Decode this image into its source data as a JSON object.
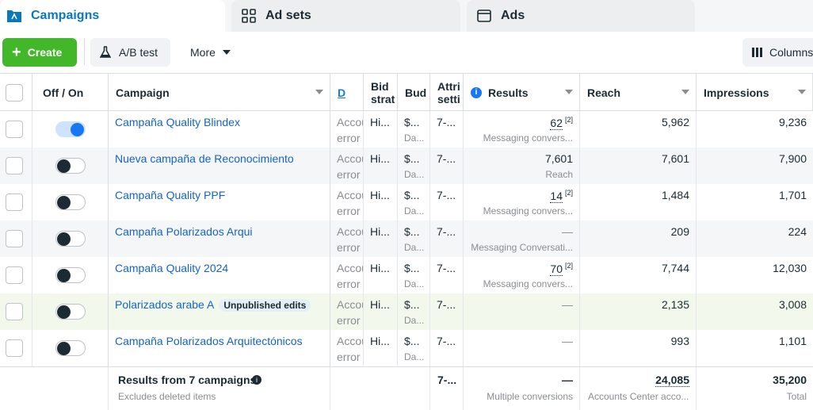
{
  "tabs": [
    {
      "label": "Campaigns",
      "icon": "folder-icon"
    },
    {
      "label": "Ad sets",
      "icon": "grid-icon"
    },
    {
      "label": "Ads",
      "icon": "ad-icon"
    }
  ],
  "toolbar": {
    "create_label": "Create",
    "ab_test_label": "A/B test",
    "more_label": "More",
    "columns_label": "Columns"
  },
  "columns": {
    "off_on": "Off / On",
    "campaign": "Campaign",
    "delivery": "D",
    "bid_strategy_line1": "Bid",
    "bid_strategy_line2": "strat",
    "budget": "Bud",
    "attribution_line1": "Attri",
    "attribution_line2": "setti",
    "results": "Results",
    "reach": "Reach",
    "impressions": "Impressions"
  },
  "rows": [
    {
      "campaign": "Campaña Quality Blindex",
      "on": true,
      "delivery": "Accou",
      "delivery_sub": "error",
      "bid": "Hi...",
      "budget": "$...",
      "budget_sub": "Da...",
      "attribution": "7-...",
      "results": "62",
      "results_sup": "[2]",
      "results_sub": "Messaging convers...",
      "reach": "5,962",
      "impressions": "9,236"
    },
    {
      "campaign": "Nueva campaña de Reconocimiento",
      "on": false,
      "delivery": "Accou",
      "delivery_sub": "error",
      "bid": "Hi...",
      "budget": "$...",
      "budget_sub": "Da...",
      "attribution": "7-...",
      "results": "7,601",
      "results_sup": "",
      "results_sub": "Reach",
      "reach": "7,601",
      "impressions": "7,900"
    },
    {
      "campaign": "Campaña Quality PPF",
      "on": false,
      "delivery": "Accou",
      "delivery_sub": "error",
      "bid": "Hi...",
      "budget": "$...",
      "budget_sub": "Da...",
      "attribution": "7-...",
      "results": "14",
      "results_sup": "[2]",
      "results_sub": "Messaging convers...",
      "reach": "1,484",
      "impressions": "1,701"
    },
    {
      "campaign": "Campaña Polarizados Arqui",
      "on": false,
      "delivery": "Accou",
      "delivery_sub": "error",
      "bid": "Hi...",
      "budget": "$...",
      "budget_sub": "Da...",
      "attribution": "7-...",
      "results": "—",
      "results_sup": "",
      "results_sub": "Messaging Conversati...",
      "reach": "209",
      "impressions": "224"
    },
    {
      "campaign": "Campaña Quality 2024",
      "on": false,
      "delivery": "Accou",
      "delivery_sub": "error",
      "bid": "Hi...",
      "budget": "$...",
      "budget_sub": "Da...",
      "attribution": "7-...",
      "results": "70",
      "results_sup": "[2]",
      "results_sub": "Messaging convers...",
      "reach": "7,744",
      "impressions": "12,030"
    },
    {
      "campaign": "Polarizados arabe A",
      "badge": "Unpublished edits",
      "on": false,
      "delivery": "Accou",
      "delivery_sub": "error",
      "bid": "Hi...",
      "budget": "$...",
      "budget_sub": "Da...",
      "attribution": "7-...",
      "results": "—",
      "results_sup": "",
      "results_sub": "",
      "reach": "2,135",
      "impressions": "3,008"
    },
    {
      "campaign": "Campaña Polarizados Arquitectónicos",
      "on": false,
      "delivery": "Accou",
      "delivery_sub": "error",
      "bid": "Hi...",
      "budget": "$...",
      "budget_sub": "Da...",
      "attribution": "7-...",
      "results": "—",
      "results_sup": "",
      "results_sub": "",
      "reach": "993",
      "impressions": "1,101"
    }
  ],
  "footer": {
    "title": "Results from 7 campaigns",
    "subtitle": "Excludes deleted items",
    "attribution": "7-...",
    "results": "—",
    "results_sub": "Multiple conversions",
    "reach": "24,085",
    "reach_sub": "Accounts Center acco...",
    "impressions": "35,200",
    "impressions_sub": "Total"
  },
  "colors": {
    "accent": "#1877f2",
    "link": "#1464c8",
    "create_green": "#42b72a",
    "row_alt": "#f5f6f7",
    "row_highlight": "#f2f9ec"
  }
}
